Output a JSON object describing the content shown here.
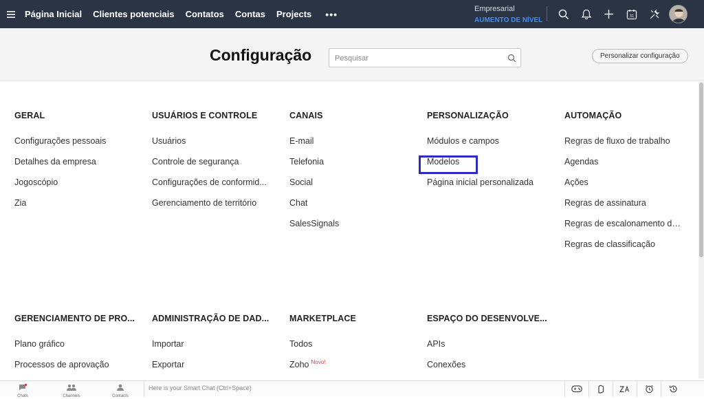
{
  "topnav": {
    "items": [
      "Página Inicial",
      "Clientes potenciais",
      "Contatos",
      "Contas",
      "Projects"
    ],
    "more": "•••",
    "plan_name": "Empresarial",
    "plan_upgrade": "AUMENTO DE NÍVEL",
    "icons": [
      "search-icon",
      "bell-icon",
      "plus-icon",
      "calendar-icon",
      "tools-icon"
    ],
    "calendar_day": "31"
  },
  "header": {
    "title": "Configuração",
    "search_placeholder": "Pesquisar",
    "search_value": "",
    "customize_label": "Personalizar configuração"
  },
  "sections": [
    {
      "title": "GERAL",
      "items": [
        "Configurações pessoais",
        "Detalhes da empresa",
        "Jogoscópio",
        "Zia"
      ]
    },
    {
      "title": "USUÁRIOS E CONTROLE",
      "items": [
        "Usuários",
        "Controle de segurança",
        "Configurações de conformid...",
        "Gerenciamento de território"
      ]
    },
    {
      "title": "CANAIS",
      "items": [
        "E-mail",
        "Telefonia",
        "Social",
        "Chat",
        "SalesSignals"
      ]
    },
    {
      "title": "PERSONALIZAÇÃO",
      "items": [
        "Módulos e campos",
        "Modelos",
        "Página inicial personalizada"
      ]
    },
    {
      "title": "AUTOMAÇÃO",
      "items": [
        "Regras de fluxo de trabalho",
        "Agendas",
        "Ações",
        "Regras de assinatura",
        "Regras de escalonamento de...",
        "Regras de classificação"
      ]
    },
    {
      "title": "GERENCIAMENTO DE PRO...",
      "items": [
        "Plano gráfico",
        "Processos de aprovação"
      ]
    },
    {
      "title": "ADMINISTRAÇÃO DE DAD...",
      "items": [
        "Importar",
        "Exportar"
      ]
    },
    {
      "title": "MARKETPLACE",
      "items": [
        "Todos",
        "Zoho"
      ],
      "badge": "Novo!"
    },
    {
      "title": "ESPAÇO DO DESENVOLVE...",
      "items": [
        "APIs",
        "Conexões"
      ]
    }
  ],
  "bottombar": {
    "items": [
      "Chats",
      "Channels",
      "Contacts"
    ],
    "smartchat_placeholder": "Here is your Smart Chat (Ctrl+Space)",
    "tools": [
      "gamepad-icon",
      "leaf-icon",
      "translate-icon",
      "alarm-icon",
      "history-icon"
    ]
  },
  "colors": {
    "nav_bg": "#2b3445",
    "upgrade": "#3e8ef7",
    "highlight": "#2c2cbf",
    "badge_new": "#e23b3b"
  }
}
